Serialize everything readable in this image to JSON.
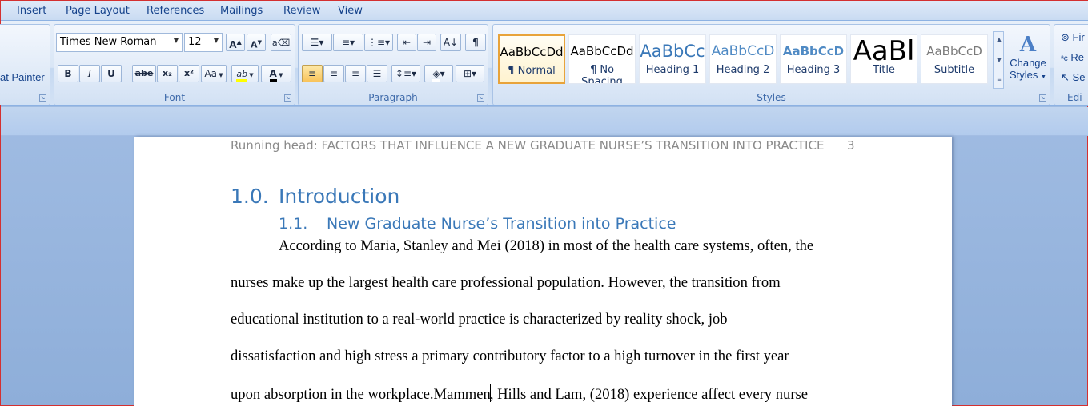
{
  "tabs": [
    "Insert",
    "Page Layout",
    "References",
    "Mailings",
    "Review",
    "View"
  ],
  "clipboard": {
    "format_painter": "at Painter"
  },
  "font": {
    "group_label": "Font",
    "family": "Times New Roman",
    "size": "12",
    "grow": "A",
    "shrink": "A",
    "bold": "B",
    "italic": "I",
    "underline": "U",
    "strike": "abe",
    "subscript": "x₂",
    "superscript": "x²",
    "change_case": "Aa",
    "highlight": "ab",
    "font_color_letter": "A"
  },
  "paragraph": {
    "group_label": "Paragraph",
    "pilcrow": "¶"
  },
  "styles": {
    "group_label": "Styles",
    "tiles": [
      {
        "sample": "AaBbCcDd",
        "name": "¶ Normal"
      },
      {
        "sample": "AaBbCcDd",
        "name": "¶ No Spacing"
      },
      {
        "sample": "AaBbCc",
        "name": "Heading 1"
      },
      {
        "sample": "AaBbCcD",
        "name": "Heading 2"
      },
      {
        "sample": "AaBbCcD",
        "name": "Heading 3"
      },
      {
        "sample": "AaBl",
        "name": "Title"
      },
      {
        "sample": "AaBbCcD",
        "name": "Subtitle"
      }
    ],
    "change_styles_line1": "Change",
    "change_styles_line2": "Styles"
  },
  "editing": {
    "group_label": "Edi",
    "find": "Fir",
    "replace": "Re",
    "select": "Se"
  },
  "document": {
    "running_head": "Running head: FACTORS THAT INFLUENCE A NEW GRADUATE NURSE’S TRANSITION INTO PRACTICE",
    "page_number": "3",
    "heading1_num": "1.0.",
    "heading1": "Introduction",
    "heading2_num": "1.1.",
    "heading2": "New Graduate Nurse’s Transition into Practice",
    "lines": [
      "According to Maria, Stanley and Mei (2018) in most of the health care systems, often, the",
      "nurses make up the largest health care professional population. However,  the transition from",
      "educational institution to a real-world practice is characterized by reality shock, job",
      "dissatisfaction and high stress a primary contributory factor to a high turnover in the first year"
    ],
    "last_line_before_caret": "upon absorption in the workplace.Mammen",
    "last_line_after_caret": ", Hills and Lam,  (2018) experience affect every nurse"
  },
  "colors": {
    "accent": "#15428b",
    "heading": "#3a78b8",
    "selected_style": "#e8a33a"
  }
}
